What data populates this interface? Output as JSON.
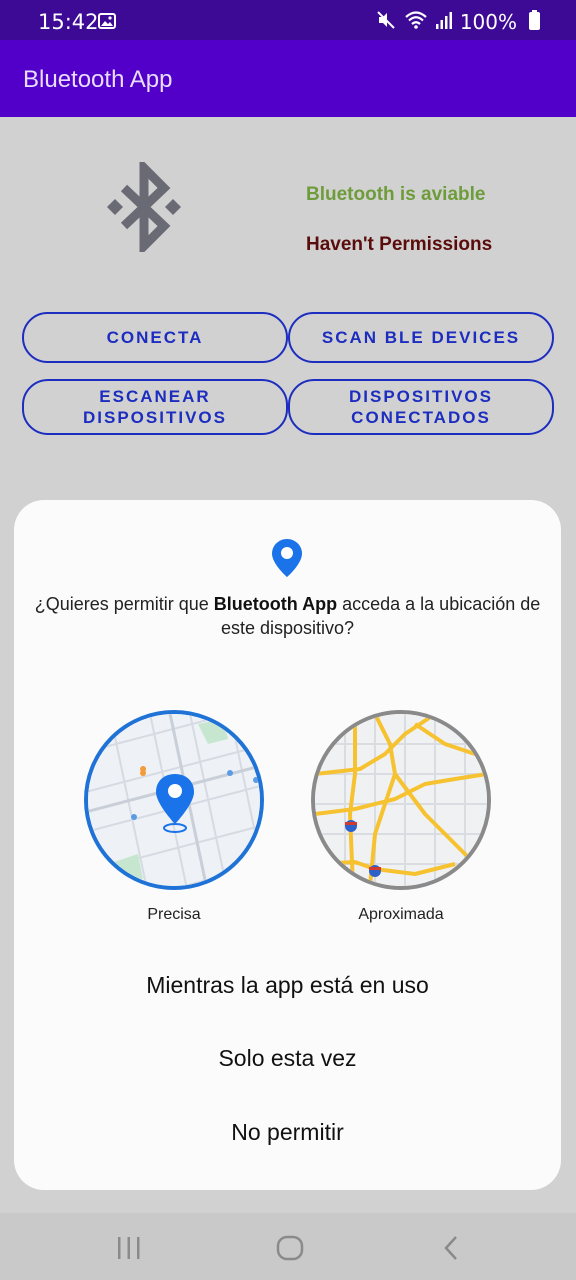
{
  "status_bar": {
    "time": "15:42",
    "battery": "100%",
    "icons": [
      "image-icon",
      "mute-icon",
      "wifi-icon",
      "signal-icon",
      "battery-icon"
    ]
  },
  "app_bar": {
    "title": "Bluetooth App"
  },
  "main": {
    "bluetooth_status": "Bluetooth is aviable",
    "permission_status": "Haven't Permissions",
    "colors": {
      "ok": "#6f9c3a",
      "error": "#5a0c0c",
      "button": "#1c2dbf"
    },
    "buttons": {
      "conecta": "CONECTA",
      "scan_ble": "SCAN BLE DEVICES",
      "escanear_line1": "ESCANEAR",
      "escanear_line2": "DISPOSITIVOS",
      "conectados_line1": "DISPOSITIVOS",
      "conectados_line2": "CONECTADOS"
    }
  },
  "dialog": {
    "question_prefix": "¿Quieres permitir que ",
    "question_app": "Bluetooth App",
    "question_suffix": " acceda a la ubicación de este dispositivo?",
    "precise_label": "Precisa",
    "approx_label": "Aproximada",
    "options": [
      "Mientras la app está en uso",
      "Solo esta vez",
      "No permitir"
    ]
  },
  "nav_bar": {
    "icons": [
      "recents-icon",
      "home-icon",
      "back-icon"
    ]
  }
}
